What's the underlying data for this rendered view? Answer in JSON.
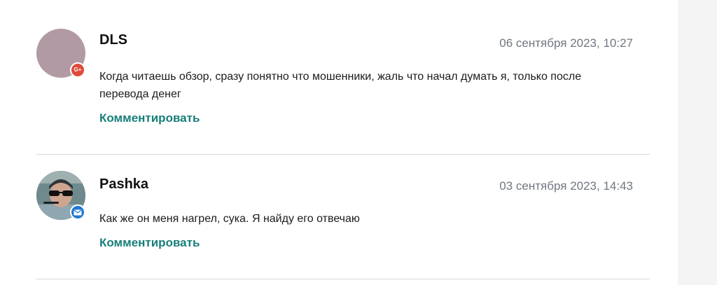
{
  "comments": [
    {
      "author": "DLS",
      "date": "06 сентября 2023, 10:27",
      "text": "Когда читаешь обзор, сразу понятно что мошенники, жаль что начал думать я, только после перевода денег",
      "reply_label": "Комментировать",
      "badge_icon": "google-plus-icon",
      "badge_label": "G+",
      "avatar_color": "#b29aa4"
    },
    {
      "author": "Pashka",
      "date": "03 сентября 2023, 14:43",
      "text": "Как же он меня нагрел, сука. Я найду его отвечаю",
      "reply_label": "Комментировать",
      "badge_icon": "mail-icon",
      "avatar_icon": "user-photo"
    }
  ],
  "colors": {
    "accent_link": "#167f7a",
    "date_gray": "#6f7780",
    "divider": "#d9d9d9",
    "google_badge": "#e04a3a",
    "mail_badge": "#1f7ad1"
  }
}
